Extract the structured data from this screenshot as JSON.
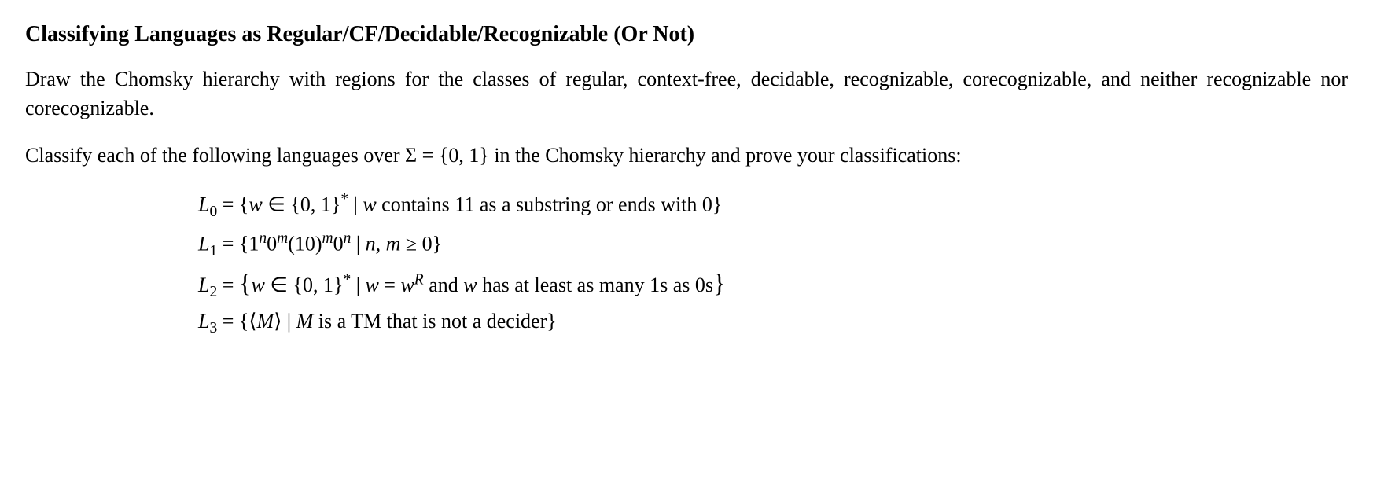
{
  "heading": "Classifying Languages as Regular/CF/Decidable/Recognizable (Or Not)",
  "para1": "Draw the Chomsky hierarchy with regions for the classes of regular, context-free, decidable, recognizable, corecognizable, and neither recognizable nor corecognizable.",
  "para2_pre": "Classify each of the following languages over ",
  "para2_sigma": "Σ",
  "para2_eq": " = ",
  "para2_set": "{0, 1}",
  "para2_post": " in the Chomsky hierarchy and prove your classifications:",
  "eq": {
    "l0": {
      "lhs_var": "L",
      "lhs_sub": "0",
      "eq": " = ",
      "open": "{",
      "w": "w",
      "in": " ∈ ",
      "set": "{0, 1}",
      "star": "*",
      "bar": " | ",
      "w2": "w",
      "text": " contains 11 as a substring or ends with 0",
      "close": "}"
    },
    "l1": {
      "lhs_var": "L",
      "lhs_sub": "1",
      "eq": " = ",
      "open": "{",
      "one": "1",
      "n1": "n",
      "zero1": "0",
      "m1": "m",
      "ten": "(10)",
      "m2": "m",
      "zero2": "0",
      "n2": "n",
      "bar": " | ",
      "nm": "n, m",
      "geq": " ≥ 0",
      "close": "}"
    },
    "l2": {
      "lhs_var": "L",
      "lhs_sub": "2",
      "eq": " = ",
      "open": "{",
      "w": "w",
      "in": " ∈ ",
      "set": "{0, 1}",
      "star": "*",
      "bar": " | ",
      "w2": "w",
      "eq2": " = ",
      "w3": "w",
      "r": "R",
      "and": " and ",
      "w4": "w",
      "text": " has at least as many 1s as 0s",
      "close": "}"
    },
    "l3": {
      "lhs_var": "L",
      "lhs_sub": "3",
      "eq": " = ",
      "open": "{",
      "langle": "⟨",
      "m": "M",
      "rangle": "⟩",
      "bar": " | ",
      "m2": "M",
      "text": " is a TM that is not a decider",
      "close": "}"
    }
  }
}
